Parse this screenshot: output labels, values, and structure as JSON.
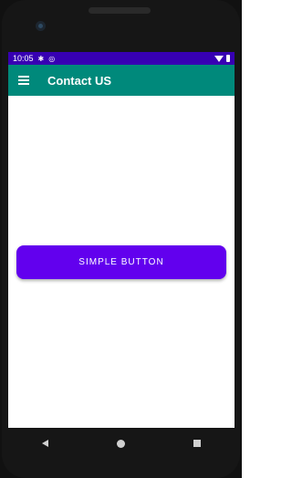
{
  "status_bar": {
    "time": "10:05",
    "icons": [
      "settings-icon",
      "data-saver-icon",
      "wifi-icon",
      "battery-icon"
    ]
  },
  "app_bar": {
    "title": "Contact US",
    "menu_icon": "hamburger-menu-icon",
    "background": "#00897b"
  },
  "main": {
    "button_label": "SIMPLE BUTTON",
    "button_color": "#6200ee"
  },
  "nav_bar": {
    "icons": [
      "back-icon",
      "home-icon",
      "recents-icon"
    ]
  },
  "colors": {
    "status_bar": "#3700b3",
    "accent": "#6200ee"
  }
}
